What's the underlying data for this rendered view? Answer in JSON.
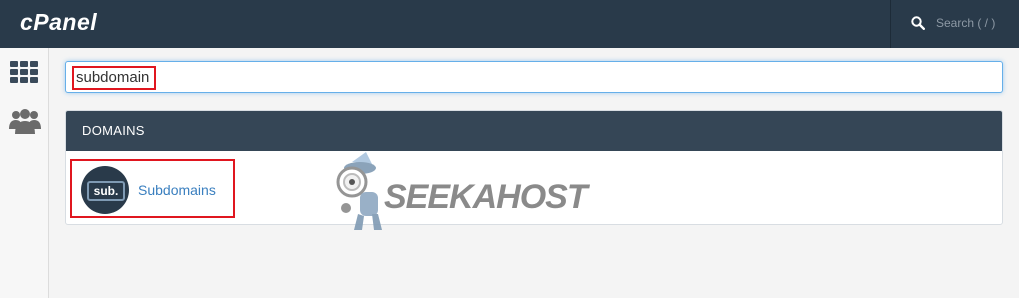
{
  "header": {
    "logo": "cPanel",
    "search_placeholder": "Search ( / )"
  },
  "sidebar": {
    "items": [
      {
        "icon": "grid-icon"
      },
      {
        "icon": "users-icon"
      }
    ]
  },
  "search": {
    "value": "subdomain"
  },
  "domains_panel": {
    "title": "DOMAINS",
    "items": [
      {
        "icon_text": "sub.",
        "label": "Subdomains"
      }
    ]
  },
  "watermark": {
    "text": "SEEKAHOST"
  },
  "colors": {
    "topbar": "#293a4a",
    "panel_header": "#354656",
    "highlight": "#e0161f",
    "link": "#3a7fbf",
    "focus": "#66afe9"
  }
}
